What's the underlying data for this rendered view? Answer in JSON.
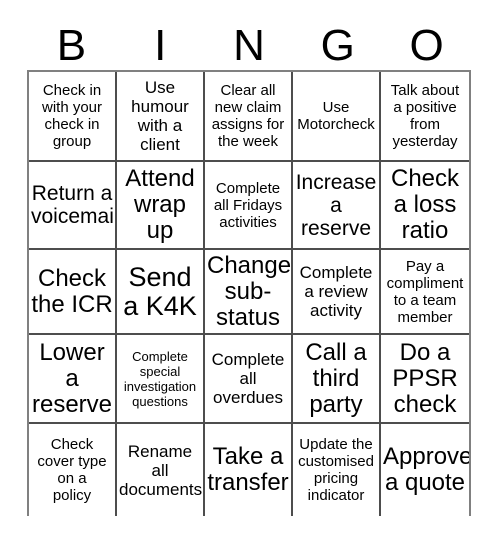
{
  "card": {
    "title_letters": [
      "B",
      "I",
      "N",
      "G",
      "O"
    ],
    "columns": 5,
    "rows": 5,
    "colors": {
      "background": "#ffffff",
      "text": "#000000",
      "grid_line": "#4d4d4d",
      "outer_border": "#808080"
    },
    "cells": [
      {
        "text": "Check in\nwith your\ncheck in\ngroup",
        "size": "sm"
      },
      {
        "text": "Use\nhumour\nwith a\nclient",
        "size": "md"
      },
      {
        "text": "Clear all\nnew claim\nassigns for\nthe week",
        "size": "sm"
      },
      {
        "text": "Use\nMotorcheck",
        "size": "sm"
      },
      {
        "text": "Talk about\na positive\nfrom\nyesterday",
        "size": "sm"
      },
      {
        "text": "Return a\nvoicemail",
        "size": "lg"
      },
      {
        "text": "Attend\nwrap\nup",
        "size": "xl"
      },
      {
        "text": "Complete\nall Fridays\nactivities",
        "size": "sm"
      },
      {
        "text": "Increase\na\nreserve",
        "size": "lg"
      },
      {
        "text": "Check\na loss\nratio",
        "size": "xl"
      },
      {
        "text": "Check\nthe ICR",
        "size": "xl"
      },
      {
        "text": "Send\na K4K",
        "size": "xxl"
      },
      {
        "text": "Change\nsub-\nstatus",
        "size": "xl"
      },
      {
        "text": "Complete\na review\nactivity",
        "size": "md"
      },
      {
        "text": "Pay a\ncompliment\nto a team\nmember",
        "size": "sm"
      },
      {
        "text": "Lower\na\nreserve",
        "size": "xl"
      },
      {
        "text": "Complete\nspecial\ninvestigation\nquestions",
        "size": "xs"
      },
      {
        "text": "Complete\nall\noverdues",
        "size": "md"
      },
      {
        "text": "Call a\nthird\nparty",
        "size": "xl"
      },
      {
        "text": "Do a\nPPSR\ncheck",
        "size": "xl"
      },
      {
        "text": "Check\ncover type\non a\npolicy",
        "size": "sm"
      },
      {
        "text": "Rename\nall\ndocuments",
        "size": "md"
      },
      {
        "text": "Take a\ntransfer",
        "size": "xl"
      },
      {
        "text": "Update the\ncustomised\npricing\nindicator",
        "size": "sm"
      },
      {
        "text": "Approve\na quote",
        "size": "xl"
      }
    ]
  }
}
